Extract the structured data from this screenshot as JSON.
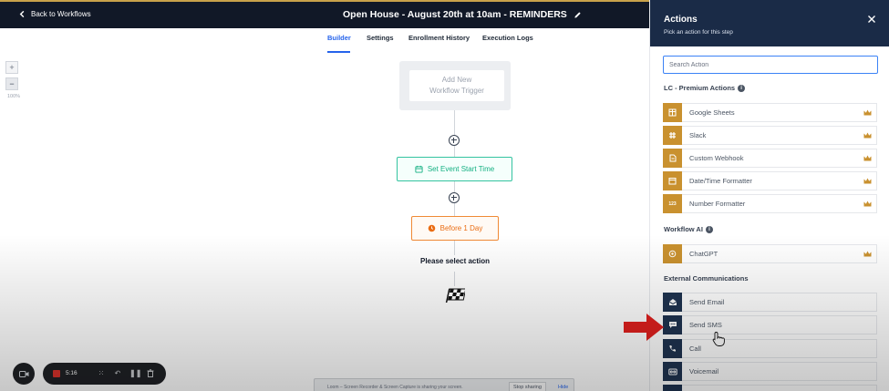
{
  "topbar": {
    "back_label": "Back to Workflows",
    "workflow_title": "Open House - August 20th at 10am - REMINDERS"
  },
  "tabs": [
    {
      "label": "Builder",
      "active": true
    },
    {
      "label": "Settings",
      "active": false
    },
    {
      "label": "Enrollment History",
      "active": false
    },
    {
      "label": "Execution Logs",
      "active": false
    }
  ],
  "zoom": {
    "zoom_in": "+",
    "zoom_out": "−",
    "level": "100%"
  },
  "canvas": {
    "trigger_line1": "Add New",
    "trigger_line2": "Workflow Trigger",
    "step1_label": "Set Event Start Time",
    "step2_label": "Before 1 Day",
    "prompt": "Please select action"
  },
  "recorder": {
    "time": "5:16"
  },
  "loom_banner": {
    "text": "Loom – Screen Recorder & Screen Capture is sharing your screen.",
    "stop_label": "Stop sharing",
    "hide_label": "Hide"
  },
  "panel": {
    "title": "Actions",
    "subtitle": "Pick an action for this step",
    "search_placeholder": "Search Action",
    "sections": [
      {
        "title": "LC - Premium Actions"
      },
      {
        "title": "Workflow AI"
      },
      {
        "title": "External Communications"
      }
    ],
    "premium_items": [
      {
        "label": "Google Sheets",
        "icon": "sheets-icon"
      },
      {
        "label": "Slack",
        "icon": "slack-icon"
      },
      {
        "label": "Custom Webhook",
        "icon": "webhook-icon"
      },
      {
        "label": "Date/Time Formatter",
        "icon": "calendar-icon"
      },
      {
        "label": "Number Formatter",
        "icon": "number-icon"
      }
    ],
    "ai_items": [
      {
        "label": "ChatGPT",
        "icon": "chatgpt-icon"
      }
    ],
    "external_items": [
      {
        "label": "Send Email",
        "icon": "email-icon"
      },
      {
        "label": "Send SMS",
        "icon": "sms-icon"
      },
      {
        "label": "Call",
        "icon": "phone-icon"
      },
      {
        "label": "Voicemail",
        "icon": "voicemail-icon"
      }
    ]
  },
  "colors": {
    "topbar_bg": "#111827",
    "panel_header_bg": "#1a2b47",
    "premium_icon_bg": "#c9912f",
    "comm_icon_bg": "#1f3350",
    "active_tab": "#2563eb",
    "step_green": "#14b082",
    "step_orange": "#ea6c12",
    "annotation_arrow": "#e0201e"
  }
}
